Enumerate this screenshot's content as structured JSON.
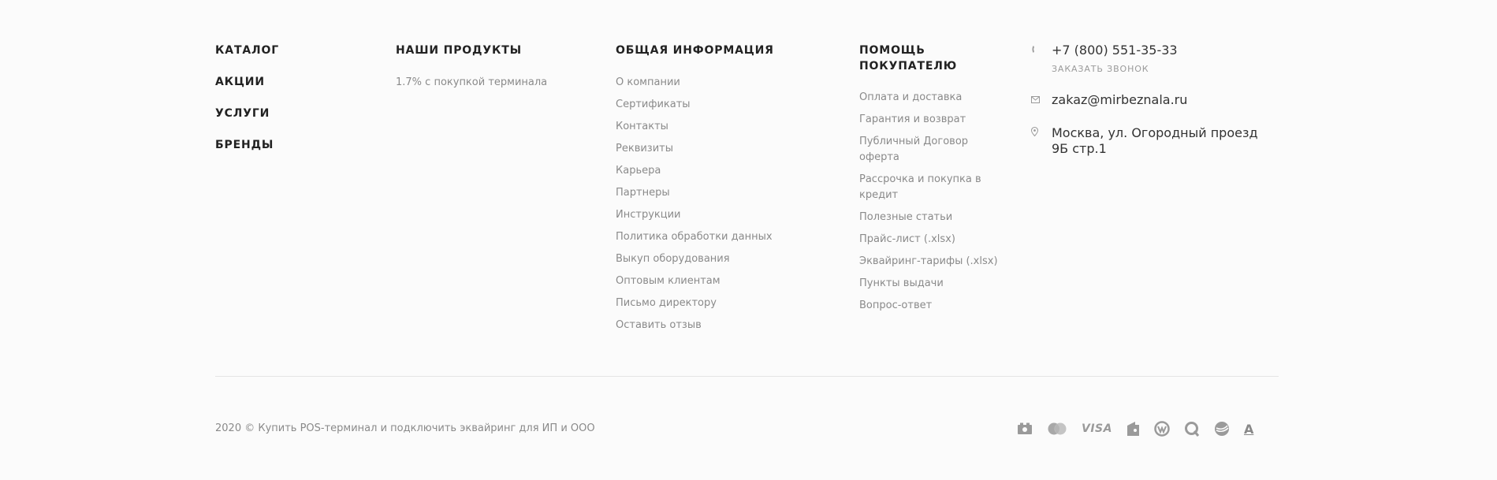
{
  "catalog": {
    "items": [
      "КАТАЛОГ",
      "АКЦИИ",
      "УСЛУГИ",
      "БРЕНДЫ"
    ]
  },
  "products": {
    "heading": "НАШИ ПРОДУКТЫ",
    "items": [
      "1.7% с покупкой терминала"
    ]
  },
  "info": {
    "heading": "ОБЩАЯ ИНФОРМАЦИЯ",
    "items": [
      "О компании",
      "Сертификаты",
      "Контакты",
      "Реквизиты",
      "Карьера",
      "Партнеры",
      "Инструкции",
      "Политика обработки данных",
      "Выкуп оборудования",
      "Оптовым клиентам",
      "Письмо директору",
      "Оставить отзыв"
    ]
  },
  "help": {
    "heading_line1": "ПОМОЩЬ",
    "heading_line2": "ПОКУПАТЕЛЮ",
    "items": [
      {
        "line1": "Оплата и доставка",
        "line2": ""
      },
      {
        "line1": "Гарантия и возврат",
        "line2": ""
      },
      {
        "line1": "Публичный Договор",
        "line2": "оферта"
      },
      {
        "line1": "Рассрочка и покупка в",
        "line2": "кредит"
      },
      {
        "line1": "Полезные статьи",
        "line2": ""
      },
      {
        "line1": "Прайс-лист (.xlsx)",
        "line2": ""
      },
      {
        "line1": "Эквайринг-тарифы (.xlsx)",
        "line2": ""
      },
      {
        "line1": "Пункты выдачи",
        "line2": ""
      },
      {
        "line1": "Вопрос-ответ",
        "line2": ""
      }
    ]
  },
  "contacts": {
    "phone": "+7 (800) 551-35-33",
    "callback_label": "ЗАКАЗАТЬ ЗВОНОК",
    "email": "zakaz@mirbeznala.ru",
    "address_line1": "Москва, ул. Огородный проезд",
    "address_line2": "9Б стр.1",
    "icons": [
      "phone-icon",
      "mail-icon",
      "location-pin-icon"
    ]
  },
  "bottom": {
    "copyright": "2020 © Купить POS-терминал и подключить эквайринг для ИП и ООО",
    "payment_methods": [
      {
        "name": "cash-icon",
        "label": ""
      },
      {
        "name": "mastercard-icon",
        "label": ""
      },
      {
        "name": "visa-icon",
        "label": "VISA"
      },
      {
        "name": "yandex-money-icon",
        "label": ""
      },
      {
        "name": "webmoney-icon",
        "label": ""
      },
      {
        "name": "qiwi-icon",
        "label": ""
      },
      {
        "name": "sberbank-icon",
        "label": ""
      },
      {
        "name": "alfa-bank-icon",
        "label": "A"
      }
    ]
  },
  "colors": {
    "background": "#fbfbfb",
    "heading": "#222222",
    "link": "#8a8a8a",
    "contact_text": "#333333",
    "divider": "#e5e5e5",
    "icon": "#9a9a9a"
  }
}
